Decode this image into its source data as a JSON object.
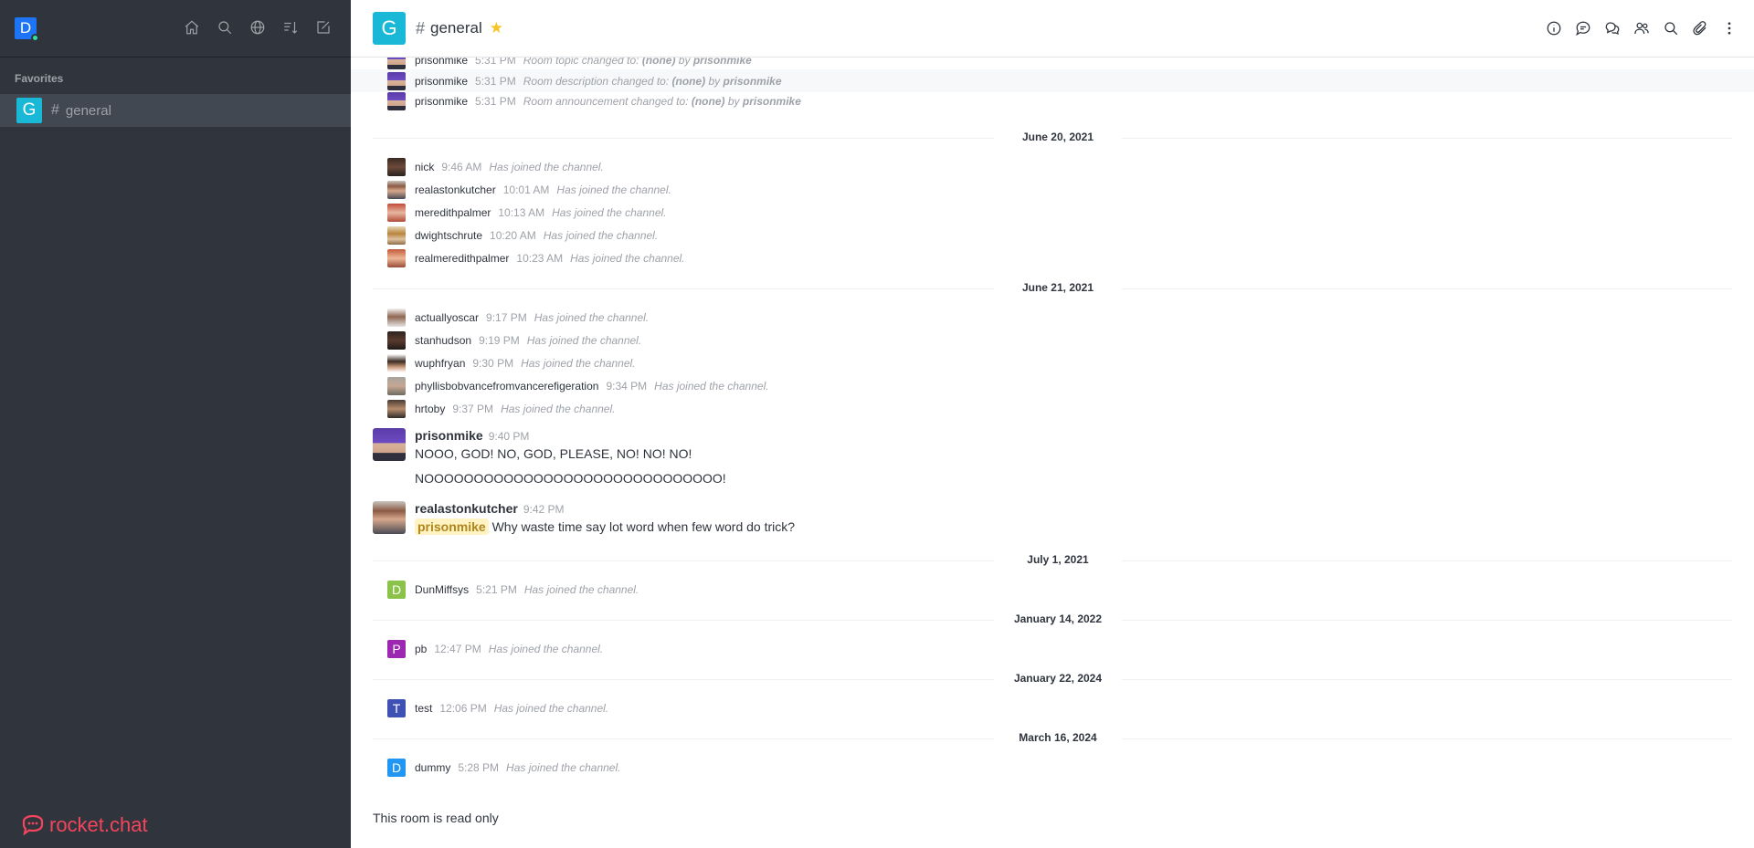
{
  "user": {
    "avatar_letter": "D"
  },
  "sidebar": {
    "tools": [
      "home-icon",
      "search-icon",
      "globe-icon",
      "sort-icon",
      "edit-icon"
    ],
    "favorites_label": "Favorites",
    "rooms": [
      {
        "avatar_letter": "G",
        "name": "general"
      }
    ],
    "brand": "rocket.chat"
  },
  "header": {
    "avatar_letter": "G",
    "title": "general",
    "tools": [
      "info-icon",
      "threads-icon",
      "discussion-icon",
      "members-icon",
      "search-icon",
      "attachment-icon",
      "kebab-icon"
    ]
  },
  "system_messages_top": [
    {
      "user": "prisonmike",
      "time": "5:31 PM",
      "prefix": "Room topic changed to: ",
      "value": "(none)",
      "by": " by ",
      "actor": "prisonmike"
    },
    {
      "user": "prisonmike",
      "time": "5:31 PM",
      "prefix": "Room description changed to: ",
      "value": "(none)",
      "by": " by ",
      "actor": "prisonmike"
    },
    {
      "user": "prisonmike",
      "time": "5:31 PM",
      "prefix": "Room announcement changed to: ",
      "value": "(none)",
      "by": " by ",
      "actor": "prisonmike"
    }
  ],
  "dates": {
    "d1": "June 20, 2021",
    "d2": "June 21, 2021",
    "d3": "July 1, 2021",
    "d4": "January 14, 2022",
    "d5": "January 22, 2024",
    "d6": "March 16, 2024"
  },
  "join_text": "Has joined the channel.",
  "joins_june20": [
    {
      "user": "nick",
      "time": "9:46 AM"
    },
    {
      "user": "realastonkutcher",
      "time": "10:01 AM"
    },
    {
      "user": "meredithpalmer",
      "time": "10:13 AM"
    },
    {
      "user": "dwightschrute",
      "time": "10:20 AM"
    },
    {
      "user": "realmeredithpalmer",
      "time": "10:23 AM"
    }
  ],
  "joins_june21": [
    {
      "user": "actuallyoscar",
      "time": "9:17 PM"
    },
    {
      "user": "stanhudson",
      "time": "9:19 PM"
    },
    {
      "user": "wuphfryan",
      "time": "9:30 PM"
    },
    {
      "user": "phyllisbobvancefromvancerefigeration",
      "time": "9:34 PM"
    },
    {
      "user": "hrtoby",
      "time": "9:37 PM"
    }
  ],
  "messages": [
    {
      "user": "prisonmike",
      "time": "9:40 PM",
      "lines": [
        "NOOO, GOD! NO, GOD, PLEASE, NO! NO! NO!",
        "NOOOOOOOOOOOOOOOOOOOOOOOOOOOOOO!"
      ]
    },
    {
      "user": "realastonkutcher",
      "time": "9:42 PM",
      "mention": "prisonmike",
      "text": " Why waste time say lot word when few word do trick?"
    }
  ],
  "late_joins": [
    {
      "user": "DunMiffsys",
      "time": "5:21 PM",
      "letter": "D",
      "color": "#8bc34a"
    },
    {
      "user": "pb",
      "time": "12:47 PM",
      "letter": "P",
      "color": "#9c27b0"
    },
    {
      "user": "test",
      "time": "12:06 PM",
      "letter": "T",
      "color": "#3f51b5"
    },
    {
      "user": "dummy",
      "time": "5:28 PM",
      "letter": "D",
      "color": "#2196f3"
    }
  ],
  "footer": {
    "readonly": "This room is read only"
  },
  "colors": {
    "sidebar_bg": "#2f343d",
    "accent": "#1d74f5",
    "room_avatar": "#19b8d6",
    "brand": "#f5455c",
    "star": "#f5c425"
  }
}
